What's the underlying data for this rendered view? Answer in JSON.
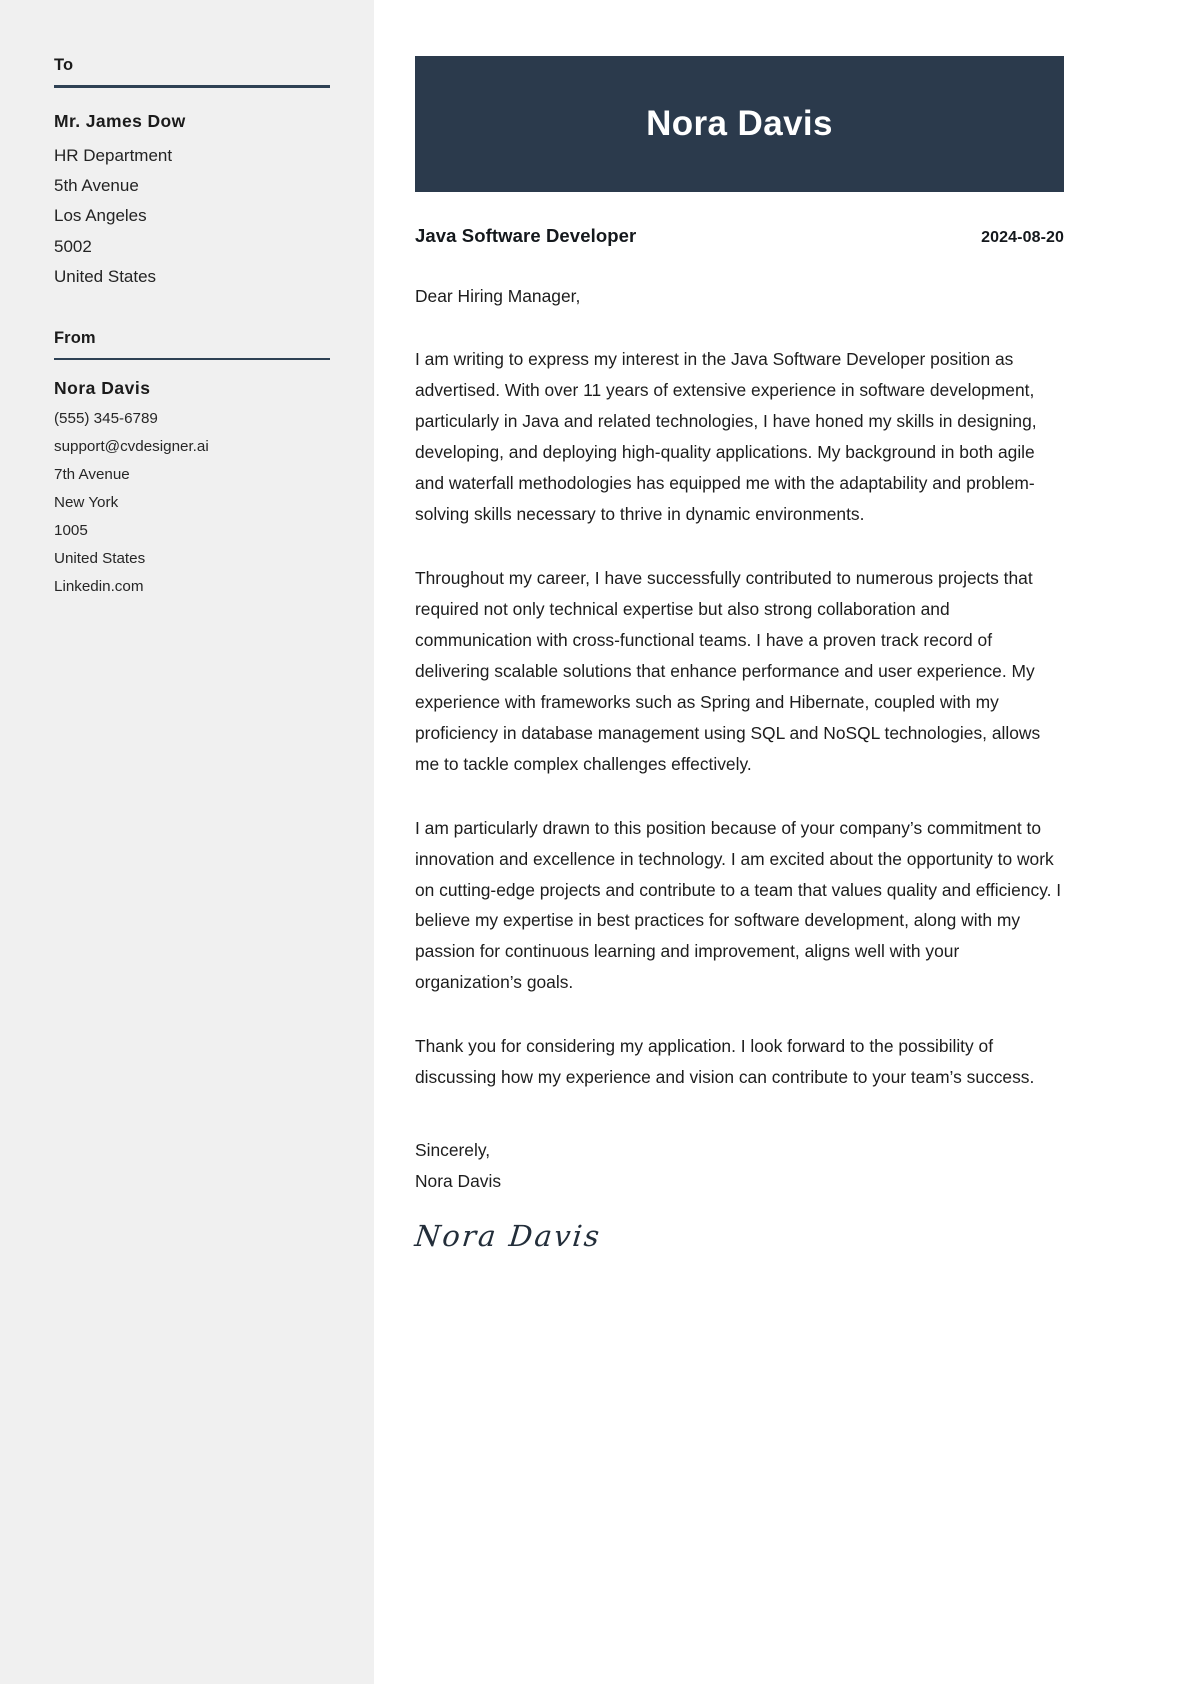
{
  "sidebar": {
    "to": {
      "heading": "To",
      "name": "Mr. James Dow",
      "lines": [
        "HR Department",
        "5th Avenue",
        "Los Angeles",
        "5002",
        "United States"
      ]
    },
    "from": {
      "heading": "From",
      "name": "Nora Davis",
      "lines": [
        "(555) 345-6789",
        "support@cvdesigner.ai",
        "7th Avenue",
        "New York",
        "1005",
        "United States",
        "Linkedin.com"
      ]
    }
  },
  "header": {
    "name": "Nora Davis",
    "banner_color": "#2b3a4c",
    "text_color": "#ffffff"
  },
  "meta": {
    "job_title": "Java Software Developer",
    "date": "2024-08-20"
  },
  "letter": {
    "salutation": "Dear Hiring Manager,",
    "paragraphs": [
      "I am writing to express my interest in the Java Software Developer position as advertised. With over 11 years of extensive experience in software development, particularly in Java and related technologies, I have honed my skills in designing, developing, and deploying high-quality applications. My background in both agile and waterfall methodologies has equipped me with the adaptability and problem-solving skills necessary to thrive in dynamic environments.",
      "Throughout my career, I have successfully contributed to numerous projects that required not only technical expertise but also strong collaboration and communication with cross-functional teams. I have a proven track record of delivering scalable solutions that enhance performance and user experience. My experience with frameworks such as Spring and Hibernate, coupled with my proficiency in database management using SQL and NoSQL technologies, allows me to tackle complex challenges effectively.",
      "I am particularly drawn to this position because of your company’s commitment to innovation and excellence in technology. I am excited about the opportunity to work on cutting-edge projects and contribute to a team that values quality and efficiency. I believe my expertise in best practices for software development, along with my passion for continuous learning and improvement, aligns well with your organization’s goals.",
      "Thank you for considering my application. I look forward to the possibility of discussing how my experience and vision can contribute to your team’s success."
    ],
    "closing_word": "Sincerely,",
    "closing_name": "Nora Davis",
    "signature": "Nora Davis"
  }
}
